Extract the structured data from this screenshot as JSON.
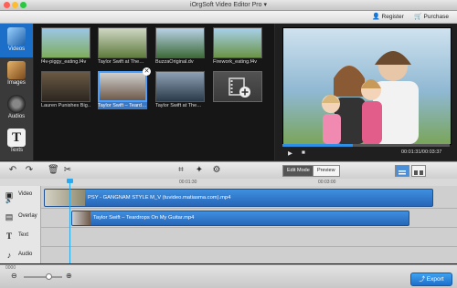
{
  "window": {
    "title": "iOrgSoft Video Editor Pro ▾"
  },
  "topbar": {
    "register_label": "Register",
    "purchase_label": "Purchase"
  },
  "sidebar": {
    "items": [
      {
        "label": "Videos",
        "icon": "film-icon"
      },
      {
        "label": "Images",
        "icon": "image-icon"
      },
      {
        "label": "Audios",
        "icon": "speaker-icon"
      },
      {
        "label": "Texts",
        "icon": "text-icon"
      }
    ]
  },
  "media": {
    "items": [
      {
        "caption": "f4v-piggy_eating.f4v"
      },
      {
        "caption": "Taylor Swift at The…"
      },
      {
        "caption": "BuzzaOriginal.dv"
      },
      {
        "caption": "Firework_eating.f4v"
      },
      {
        "caption": "Lauren Punishes Big…"
      },
      {
        "caption": "Taylor Swift – Teard…"
      },
      {
        "caption": "Taylor Swift at The…"
      }
    ]
  },
  "preview": {
    "time": "00:01:31/00:03:37",
    "progress": 0.42
  },
  "toolbar": {
    "edit_mode_label": "Edit Mode",
    "preview_label": "Preview"
  },
  "ruler": {
    "ticks": [
      "00:01:30",
      "00:03:00"
    ]
  },
  "timeline": {
    "tracks": [
      {
        "label": "Video",
        "icon": "film-icon"
      },
      {
        "label": "Overlay",
        "icon": "overlay-icon"
      },
      {
        "label": "Text",
        "icon": "text-icon"
      },
      {
        "label": "Audio",
        "icon": "note-icon"
      }
    ],
    "video_clip": "PSY - GANGNAM STYLE  M_V (tuvideo.matiasma.com).mp4",
    "overlay_clip": "Taylor Swift – Teardrops On My Guitar.mp4",
    "playhead_position": "00:00:40"
  },
  "footer": {
    "export_label": "Export",
    "ruler_marker": "0000"
  },
  "colors": {
    "accent": "#1b6fc9",
    "clip": "#3a87d8"
  }
}
